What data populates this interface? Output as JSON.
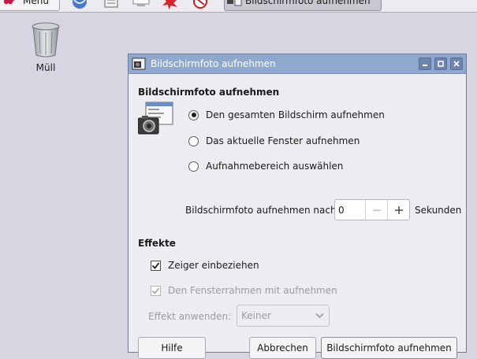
{
  "taskbar": {
    "menu_label": "Menü",
    "task_label": "Bildschirmfoto aufnehmen",
    "launcher_icons": [
      "browser-icon",
      "text-editor-icon",
      "terminal-icon",
      "math-icon",
      "wolfram-icon"
    ]
  },
  "desktop": {
    "trash_label": "Müll"
  },
  "window": {
    "title": "Bildschirmfoto aufnehmen",
    "section_capture": "Bildschirmfoto aufnehmen",
    "options": [
      {
        "label": "Den gesamten Bildschirm aufnehmen",
        "selected": true
      },
      {
        "label": "Das aktuelle Fenster aufnehmen",
        "selected": false
      },
      {
        "label": "Aufnahmebereich auswählen",
        "selected": false
      }
    ],
    "delay_label": "Bildschirmfoto aufnehmen nach",
    "delay_value": "0",
    "delay_unit": "Sekunden",
    "section_effects": "Effekte",
    "include_pointer_label": "Zeiger einbeziehen",
    "include_pointer_checked": true,
    "include_border_label": "Den Fensterrahmen mit aufnehmen",
    "include_border_checked": true,
    "effect_label": "Effekt anwenden:",
    "effect_value": "Keiner",
    "buttons": {
      "help": "Hilfe",
      "cancel": "Abbrechen",
      "capture": "Bildschirmfoto aufnehmen"
    }
  },
  "colors": {
    "titlebar": "#8fa8cf",
    "desktop": "#d7d5e2",
    "dialog_bg": "#edecf1"
  }
}
